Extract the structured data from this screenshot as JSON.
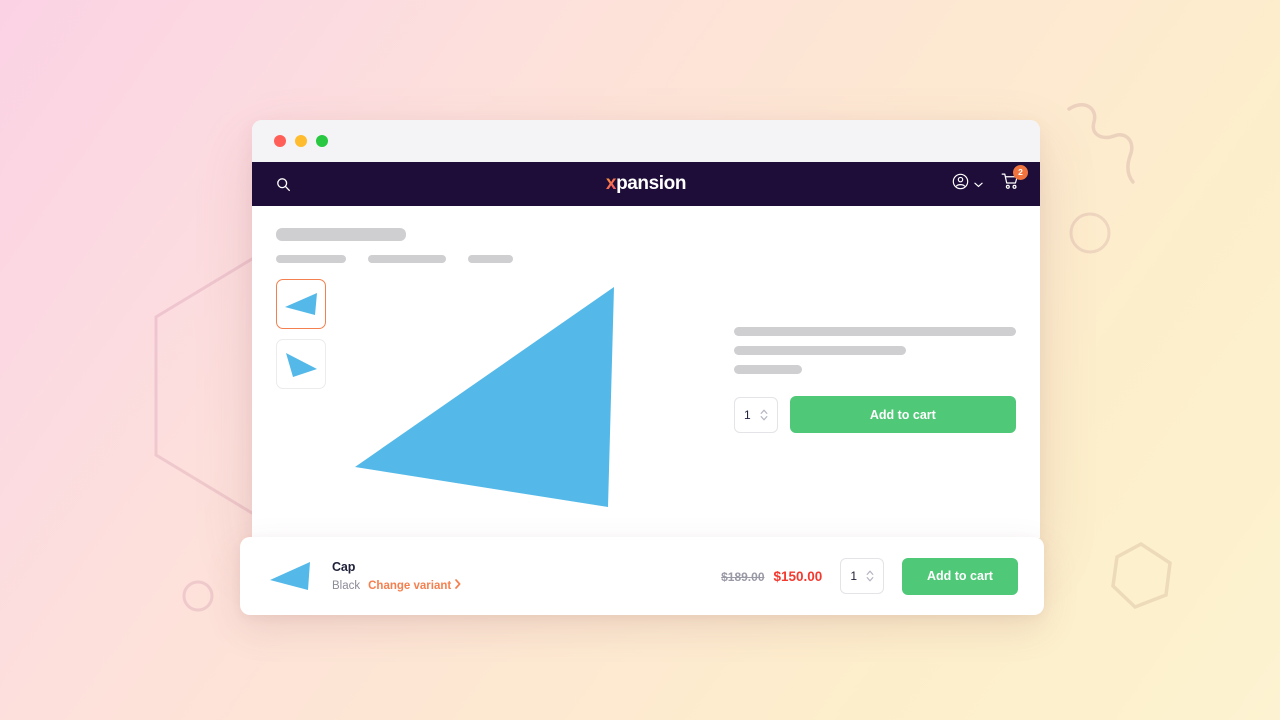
{
  "window": {
    "traffic_lights": [
      "close",
      "minimize",
      "maximize"
    ]
  },
  "navbar": {
    "search_icon": "search-icon",
    "brand": {
      "accent_char": "x",
      "rest": "pansion",
      "accent_color": "#f9734a"
    },
    "account_icon": "user-circle-icon",
    "account_chevron": "chevron-down-icon",
    "cart_icon": "shopping-cart-icon",
    "cart_count": "2",
    "background_color": "#1d0d38"
  },
  "product_page": {
    "title_placeholder_widths": [
      130
    ],
    "meta_placeholder_widths": [
      70,
      78,
      45
    ],
    "thumbnails": [
      {
        "name": "thumbnail-1",
        "selected": true
      },
      {
        "name": "thumbnail-2",
        "selected": false
      }
    ],
    "description_placeholder_widths": [
      282,
      172,
      68
    ],
    "quantity": "1",
    "add_to_cart_label": "Add to cart",
    "accent_green": "#4fc878",
    "product_color": "#54b9e8"
  },
  "sticky_bar": {
    "product_title": "Cap",
    "variant_name": "Black",
    "change_variant_label": "Change variant",
    "change_variant_chevron": "chevron-right-icon",
    "price_original": "$189.00",
    "price_sale": "$150.00",
    "quantity": "1",
    "add_to_cart_label": "Add to cart"
  }
}
